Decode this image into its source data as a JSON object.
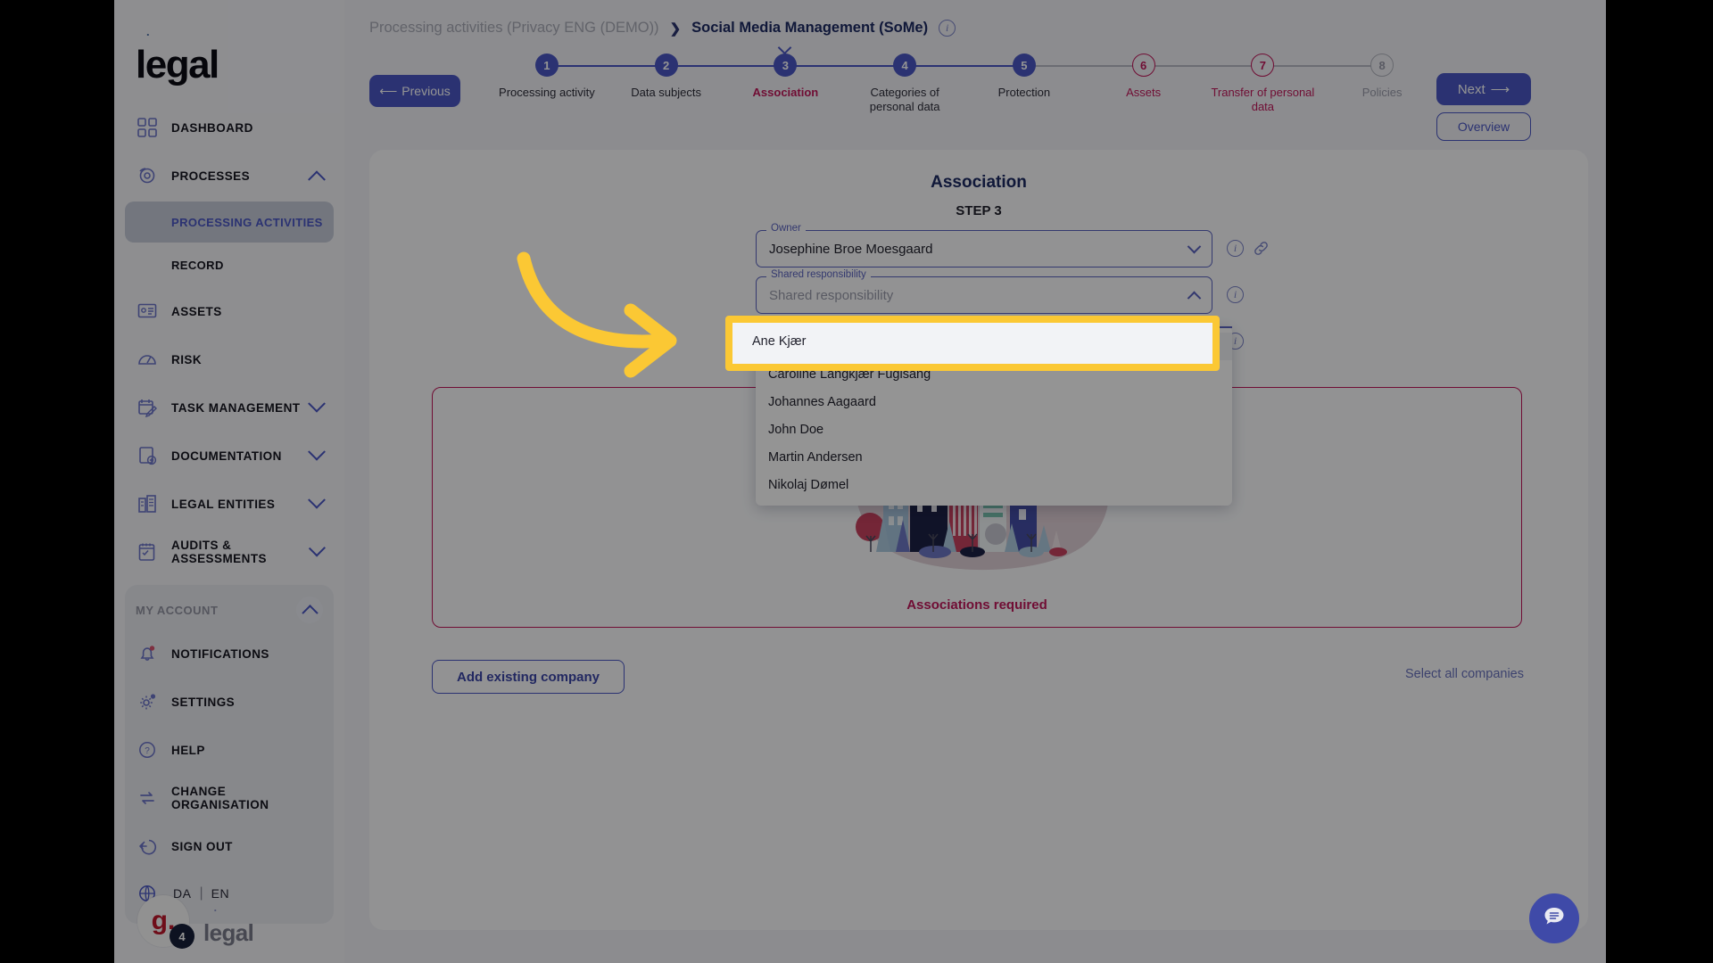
{
  "brand": {
    "logo": ".legal",
    "logo_dot": ".",
    "logo_word": "legal",
    "footer_word": "legal",
    "avatar_initial": "g.",
    "avatar_badge": "4"
  },
  "sidebar": {
    "items": [
      {
        "label": "DASHBOARD",
        "icon": "grid-icon",
        "chevron": ""
      },
      {
        "label": "PROCESSES",
        "icon": "process-icon",
        "chevron": "up"
      },
      {
        "label": "ASSETS",
        "icon": "assets-icon",
        "chevron": ""
      },
      {
        "label": "RISK",
        "icon": "risk-icon",
        "chevron": ""
      },
      {
        "label": "TASK MANAGEMENT",
        "icon": "task-icon",
        "chevron": "down"
      },
      {
        "label": "DOCUMENTATION",
        "icon": "document-icon",
        "chevron": "down"
      },
      {
        "label": "LEGAL ENTITIES",
        "icon": "building-icon",
        "chevron": "down"
      },
      {
        "label": "AUDITS & ASSESSMENTS",
        "icon": "audit-icon",
        "chevron": "down"
      }
    ],
    "sub_items": [
      {
        "label": "PROCESSING ACTIVITIES",
        "active": true
      },
      {
        "label": "RECORD",
        "active": false
      }
    ],
    "account": {
      "header": "MY ACCOUNT",
      "items": [
        {
          "label": "NOTIFICATIONS",
          "icon": "bell-icon",
          "badge": true
        },
        {
          "label": "SETTINGS",
          "icon": "gear-icon",
          "badge": true
        },
        {
          "label": "HELP",
          "icon": "question-icon",
          "badge": false
        },
        {
          "label": "CHANGE ORGANISATION",
          "icon": "swap-icon",
          "badge": false
        },
        {
          "label": "SIGN OUT",
          "icon": "signout-icon",
          "badge": false
        }
      ],
      "lang": {
        "icon": "globe-icon",
        "da": "DA",
        "sep": "|",
        "en": "EN"
      }
    }
  },
  "breadcrumb": {
    "parent": "Processing activities (Privacy ENG (DEMO))",
    "separator": "❯",
    "current": "Social Media Management (SoMe)",
    "info": "i"
  },
  "toolbar": {
    "previous_label": "Previous",
    "previous_arrow": "⟵",
    "next_label": "Next",
    "next_arrow": "⟶",
    "overview_label": "Overview"
  },
  "stepper": {
    "steps": [
      {
        "num": "1",
        "label": "Processing activity",
        "state": "filled",
        "line": "blue"
      },
      {
        "num": "2",
        "label": "Data subjects",
        "state": "filled",
        "line": "blue"
      },
      {
        "num": "3",
        "label": "Association",
        "state": "filled",
        "line": "blue",
        "current": true
      },
      {
        "num": "4",
        "label": "Categories of personal data",
        "state": "filled",
        "line": "blue"
      },
      {
        "num": "5",
        "label": "Protection",
        "state": "filled",
        "line": "grey"
      },
      {
        "num": "6",
        "label": "Assets",
        "state": "ring-red",
        "line": "grey"
      },
      {
        "num": "7",
        "label": "Transfer of personal data",
        "state": "ring-red",
        "line": "grey"
      },
      {
        "num": "8",
        "label": "Policies",
        "state": "ring-grey",
        "line": "none"
      }
    ]
  },
  "page": {
    "title": "Association",
    "step_text": "STEP 3"
  },
  "form": {
    "owner": {
      "label": "Owner",
      "value": "Josephine Broe Moesgaard",
      "info": "i",
      "link_icon": "link-icon"
    },
    "shared": {
      "label": "Shared responsibility",
      "placeholder": "Shared responsibility",
      "value": "",
      "info": "i",
      "open": true,
      "options": [
        "Ane Kjær",
        "Caroline Langkjær Fuglsang",
        "Johannes Aagaard",
        "John Doe",
        "Martin Andersen",
        "Nikolaj Dømel"
      ],
      "highlighted_option": "Ane Kjær"
    }
  },
  "empty_state": {
    "message": "Associations required",
    "illustration": "city-buildings-illustration"
  },
  "actions": {
    "add_existing_company": "Add existing company",
    "select_all_companies": "Select all companies"
  },
  "chat": {
    "icon": "chat-bubble-icon"
  },
  "annotation": {
    "arrow": "yellow-curved-arrow",
    "highlight": "yellow-highlight-box"
  },
  "colors": {
    "accent": "#4a57c4",
    "danger": "#c2185b",
    "highlight": "#fbc834",
    "navy": "#1d2a63"
  }
}
